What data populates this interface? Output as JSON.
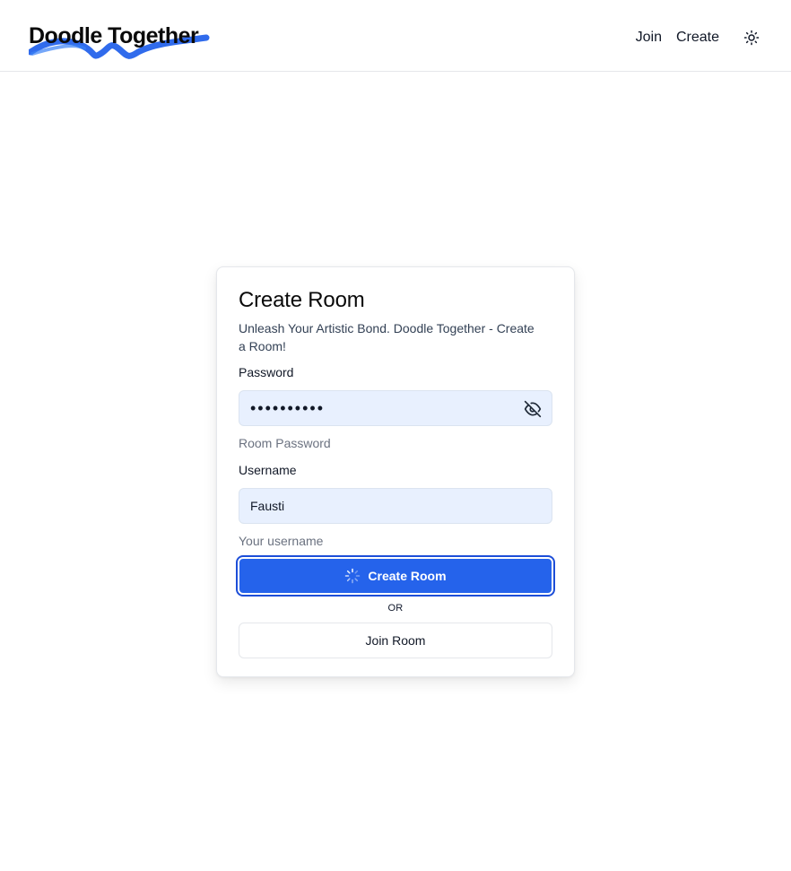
{
  "header": {
    "logo_text": "Doodle Together",
    "nav": {
      "join_label": "Join",
      "create_label": "Create"
    },
    "theme_toggle_icon": "sun-icon"
  },
  "card": {
    "title": "Create Room",
    "subtitle": "Unleash Your Artistic Bond. Doodle Together - Create a Room!",
    "password": {
      "label": "Password",
      "value": "••••••••••",
      "helper": "Room Password",
      "toggle_icon": "eye-off-icon"
    },
    "username": {
      "label": "Username",
      "value": "Fausti",
      "helper": "Your username"
    },
    "create_button": {
      "label": "Create Room",
      "icon": "spinner-icon"
    },
    "or_text": "OR",
    "join_button": {
      "label": "Join Room"
    }
  },
  "colors": {
    "primary": "#2563eb",
    "input_bg": "#e8f0fe",
    "scribble": "#2563eb"
  }
}
